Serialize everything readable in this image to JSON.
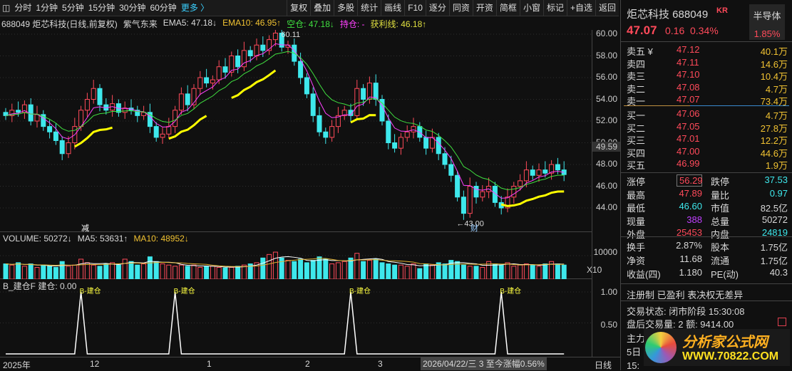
{
  "toolbar": {
    "periods": [
      "分时",
      "1分钟",
      "5分钟",
      "15分钟",
      "30分钟",
      "60分钟"
    ],
    "more": "更多 〉",
    "actions": [
      "复权",
      "叠加",
      "多股",
      "统计",
      "画线",
      "F10",
      "逐分",
      "同资",
      "开资",
      "简框",
      "小窗",
      "标记",
      "+自选",
      "返回"
    ]
  },
  "info": {
    "title": "688049 炬芯科技(日线,前复权)",
    "indicator": "紫气东来",
    "ema5": "EMA5: 47.18↓",
    "ema10": "EMA10: 46.95↑",
    "kongcang": "空仓: 47.18↓",
    "chicang": "持仓: -",
    "huoli": "获利线: 46.18↑"
  },
  "chart_data": {
    "type": "candlestick",
    "title": "688049 炬芯科技 日线",
    "ylim": [
      43,
      61
    ],
    "yticks": [
      "60.00",
      "58.00",
      "56.00",
      "54.00",
      "52.00",
      "50.00",
      "48.00",
      "46.00",
      "44.00"
    ],
    "current_label": "49.59",
    "high_label": "60.11",
    "low_label": "43.00",
    "markers": {
      "jian": "减",
      "cai": "财"
    },
    "closes": [
      52.5,
      53,
      52.8,
      53.5,
      52,
      52.6,
      51.5,
      51,
      50.2,
      49,
      50,
      51.5,
      53,
      54,
      55,
      53.5,
      53,
      53.6,
      52.8,
      53.2,
      53,
      52.5,
      52.8,
      51.5,
      50.5,
      50.8,
      51.5,
      53,
      54.5,
      53.5,
      55,
      56,
      55.5,
      55.8,
      57,
      56.5,
      58,
      57,
      58.5,
      58,
      59,
      58.5,
      59.5,
      60.1,
      58.8,
      59,
      57.5,
      56,
      54.5,
      52.5,
      51,
      50.5,
      51.5,
      52.5,
      53,
      52.5,
      55,
      54,
      55.5,
      54,
      52,
      50,
      49.5,
      50.5,
      51,
      51.5,
      50.5,
      49.5,
      50.5,
      49,
      48,
      47,
      45,
      43.5,
      46,
      45,
      45.5,
      46,
      44.5,
      44,
      45,
      46,
      46.5,
      47.5,
      47,
      47.5,
      47.2,
      48,
      47.5,
      47.07
    ],
    "volume": {
      "label": "VOLUME: 50272↓",
      "ma5": "MA5: 53631↑",
      "ma10": "MA10: 48952↓",
      "ytick": "10000",
      "unit": "X10",
      "values": [
        6500,
        6000,
        7000,
        5500,
        6500,
        5000,
        6000,
        5500,
        5000,
        7500,
        5500,
        6000,
        8500,
        7000,
        6000,
        5500,
        6500,
        7000,
        6000,
        8500,
        7500,
        6000,
        6500,
        9500,
        7500,
        6500,
        6000,
        5500,
        6000,
        5500,
        6000,
        5000,
        5500,
        5500,
        5000,
        4800,
        5000,
        5500,
        6000,
        6500,
        7000,
        9000,
        10500,
        11500,
        9000,
        8000,
        7500,
        8500,
        7000,
        8000,
        9500,
        8500,
        6500,
        7000,
        7500,
        9000,
        11000,
        7500,
        8000,
        8500,
        7000,
        6500,
        6000,
        6000,
        5500,
        6500,
        4500,
        6500,
        6000,
        7000,
        6500,
        8000,
        7500,
        6000,
        5500,
        5500,
        5000,
        7500,
        6500,
        6000,
        7000,
        5500,
        6000,
        6500,
        6000,
        5500,
        6500,
        7500,
        6500,
        6000
      ]
    },
    "indicator": {
      "label": "B_建仓F 建仓: 0.00",
      "yticks": [
        "1.00",
        "0.50"
      ],
      "signal_text": "B-建仓",
      "signal_indices": [
        12,
        27,
        55,
        79
      ]
    },
    "xlabels": [
      "2025年",
      "12",
      "1",
      "2",
      "3"
    ],
    "cursor_info": "2026/04/22/三 3 至今涨幅0.56%",
    "period": "日线"
  },
  "quote": {
    "name": "炬芯科技 688049",
    "badge": "KR",
    "sector": "半导体",
    "sector_pct": "1.85%",
    "price": "47.07",
    "change": "0.16",
    "pct": "0.34%",
    "asks": [
      {
        "l": "卖五 ¥",
        "p": "47.12",
        "v": "40.1万"
      },
      {
        "l": "卖四",
        "p": "47.11",
        "v": "14.6万"
      },
      {
        "l": "卖三",
        "p": "47.10",
        "v": "10.4万"
      },
      {
        "l": "卖二",
        "p": "47.08",
        "v": "4.7万"
      },
      {
        "l": "卖一",
        "p": "47.07",
        "v": "73.4万"
      }
    ],
    "bids": [
      {
        "l": "买一",
        "p": "47.06",
        "v": "4.7万"
      },
      {
        "l": "买二",
        "p": "47.05",
        "v": "27.8万"
      },
      {
        "l": "买三",
        "p": "47.01",
        "v": "12.2万"
      },
      {
        "l": "买四",
        "p": "47.00",
        "v": "44.6万"
      },
      {
        "l": "买五",
        "p": "46.99",
        "v": "1.9万"
      }
    ],
    "stats": [
      [
        "涨停",
        "56.29",
        "跌停",
        "37.53"
      ],
      [
        "最高",
        "47.89",
        "量比",
        "0.97"
      ],
      [
        "最低",
        "46.60",
        "市值",
        "82.5亿"
      ],
      [
        "现量",
        "388",
        "总量",
        "50272"
      ],
      [
        "外盘",
        "25453",
        "内盘",
        "24819"
      ]
    ],
    "stats2": [
      [
        "换手",
        "2.87%",
        "股本",
        "1.75亿"
      ],
      [
        "净资",
        "11.68",
        "流通",
        "1.75亿"
      ],
      [
        "收益(四)",
        "1.180",
        "PE(动)",
        "40.3"
      ]
    ],
    "notes": [
      "注册制 已盈利 表决权无差异",
      "交易状态: 闭市阶段 15:30:08",
      "盘后交易量: 2  额: 9414.00"
    ],
    "partial": [
      "主力",
      "5日",
      "15:"
    ],
    "logo": {
      "cn": "分析家公式网",
      "url": "WWW.70822.COM"
    }
  },
  "colors": {
    "up": "#ff4a5a",
    "down": "#3ee8ec",
    "ema5": "#ff40ff",
    "ema10": "#40e040",
    "profit": "#ffff00"
  }
}
